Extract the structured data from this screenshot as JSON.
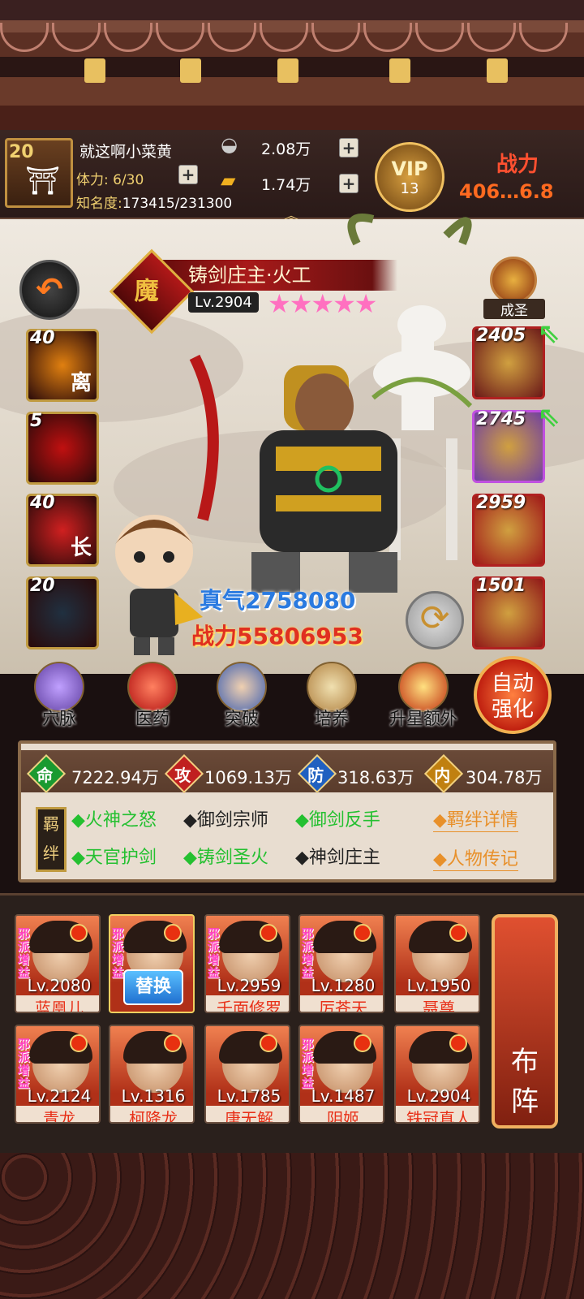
{
  "player": {
    "level": "20",
    "name": "就这啊小菜黄",
    "stamina": "体力: 6/30",
    "fame_label": "知名度:",
    "fame_value": "173415/231300"
  },
  "currency": {
    "silver": "2.08万",
    "gold": "1.74万"
  },
  "vip": {
    "label": "VIP",
    "level": "13"
  },
  "combat_power_header": {
    "label": "战力",
    "value": "406…6.8"
  },
  "hero": {
    "title": "铸剑庄主·火工",
    "sect_badge": "魔",
    "level": "Lv.2904",
    "stars": "★★★★★",
    "rank_label": "成圣",
    "zhenqi": "真气2758080",
    "power": "战力55806953"
  },
  "skills": [
    {
      "count": "40",
      "glyph": "离",
      "color": "#e08010"
    },
    {
      "count": "5",
      "glyph": "",
      "color": "#c01010"
    },
    {
      "count": "40",
      "glyph": "长",
      "color": "#d02020"
    },
    {
      "count": "20",
      "glyph": "",
      "color": "#203040"
    }
  ],
  "equipment": [
    {
      "count": "2405",
      "color": "#6a1818"
    },
    {
      "count": "2745",
      "color": "#7040a0"
    },
    {
      "count": "2959",
      "color": "#a01818"
    },
    {
      "count": "1501",
      "color": "#901818"
    }
  ],
  "functions": [
    "穴脉",
    "医药",
    "突破",
    "培养",
    "升星额外"
  ],
  "auto_button": "自动强化",
  "auto_button_lines": [
    "自动",
    "强化"
  ],
  "stats": [
    {
      "icon": "命",
      "value": "7222.94万",
      "color": "#1a9a30"
    },
    {
      "icon": "攻",
      "value": "1069.13万",
      "color": "#c02020"
    },
    {
      "icon": "防",
      "value": "318.63万",
      "color": "#2060c0"
    },
    {
      "icon": "内",
      "value": "304.78万",
      "color": "#c08010"
    }
  ],
  "bond_label": "羁绊",
  "bonds": [
    {
      "text": "◆火神之怒",
      "active": true
    },
    {
      "text": "◆御剑宗师",
      "active": false
    },
    {
      "text": "◆御剑反手",
      "active": true
    },
    {
      "text": "◆天官护剑",
      "active": true
    },
    {
      "text": "◆铸剑圣火",
      "active": true
    },
    {
      "text": "◆神剑庄主",
      "active": false
    }
  ],
  "links": {
    "bond_detail": "◆羁绊详情",
    "biography": "◆人物传记"
  },
  "roster_tag": "邪派增益",
  "replace_label": "替换",
  "roster": [
    {
      "level": "Lv.2080",
      "name": "蓝凰儿",
      "tag": true
    },
    {
      "level": "",
      "name": "",
      "tag": true,
      "selected": true
    },
    {
      "level": "Lv.2959",
      "name": "千面修罗",
      "tag": true
    },
    {
      "level": "Lv.1280",
      "name": "厉苍天",
      "tag": true
    },
    {
      "level": "Lv.1950",
      "name": "聂尊",
      "tag": false
    },
    {
      "level": "Lv.2124",
      "name": "青龙",
      "tag": true
    },
    {
      "level": "Lv.1316",
      "name": "柯降龙",
      "tag": false
    },
    {
      "level": "Lv.1785",
      "name": "唐无解",
      "tag": false
    },
    {
      "level": "Lv.1487",
      "name": "阴姬",
      "tag": true
    },
    {
      "level": "Lv.2904",
      "name": "铁冠真人",
      "tag": false
    }
  ],
  "formation_button": "布阵",
  "formation_lines": [
    "布",
    "阵"
  ]
}
